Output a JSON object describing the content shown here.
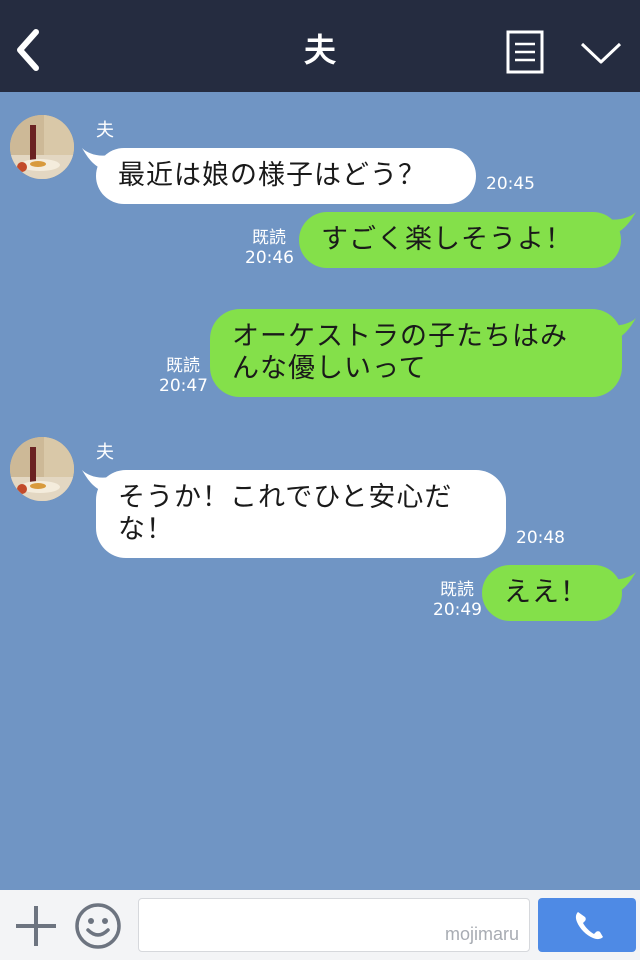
{
  "header": {
    "title": "夫",
    "back_icon": "chevron-left-icon",
    "menu_icon": "list-icon",
    "collapse_icon": "chevron-down-icon"
  },
  "messages": [
    {
      "direction": "in",
      "sender": "夫",
      "text": "最近は娘の様子はどう？",
      "time": "20:45"
    },
    {
      "direction": "out",
      "read": "既読",
      "text": "すごく楽しそうよ！",
      "time": "20:46"
    },
    {
      "direction": "out",
      "read": "既読",
      "text": "オーケストラの子たちはみんな優しいって",
      "line1": "オーケストラの子たちはみ",
      "line2": "んな優しいって",
      "time": "20:47"
    },
    {
      "direction": "in",
      "sender": "夫",
      "text": "そうか！これでひと安心だな！",
      "line1": "そうか！これでひと安心だ",
      "line2": "な！",
      "time": "20:48"
    },
    {
      "direction": "out",
      "read": "既読",
      "text": "ええ！",
      "time": "20:49"
    }
  ],
  "footer": {
    "plus_icon": "plus-icon",
    "emoji_icon": "smiley-icon",
    "input_value": "",
    "watermark": "mojimaru",
    "call_icon": "phone-icon"
  },
  "colors": {
    "header_bg": "#252c40",
    "chat_bg": "#7095c4",
    "bubble_in": "#ffffff",
    "bubble_out": "#84e04a",
    "call_button": "#4e8ae5"
  }
}
